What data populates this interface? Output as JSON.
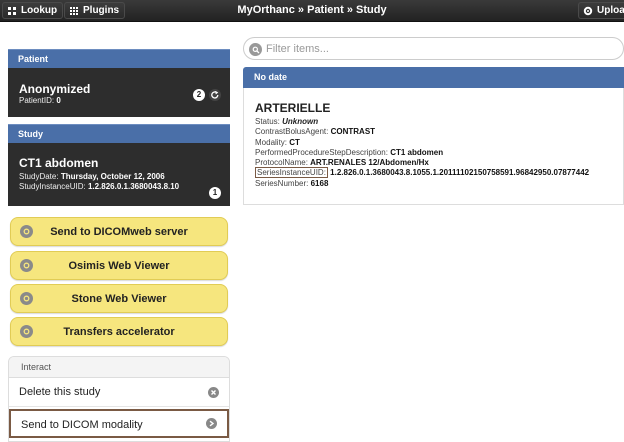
{
  "topbar": {
    "lookup_label": "Lookup",
    "plugins_label": "Plugins",
    "title": "MyOrthanc » Patient » Study",
    "upload_label": "Upload"
  },
  "patient": {
    "header": "Patient",
    "name": "Anonymized",
    "id_label": "PatientID:",
    "id_value": "0",
    "count": "2"
  },
  "study": {
    "header": "Study",
    "name": "CT1 abdomen",
    "date_label": "StudyDate:",
    "date_value": "Thursday, October 12, 2006",
    "uid_label": "StudyInstanceUID:",
    "uid_value": "1.2.826.0.1.3680043.8.10",
    "count": "1"
  },
  "actions": [
    {
      "label": "Send to DICOMweb server"
    },
    {
      "label": "Osimis Web Viewer"
    },
    {
      "label": "Stone Web Viewer"
    },
    {
      "label": "Transfers accelerator"
    }
  ],
  "interact": {
    "header": "Interact",
    "delete_label": "Delete this study",
    "send_modality_label": "Send to DICOM modality"
  },
  "filter": {
    "placeholder": "Filter items..."
  },
  "series_group": {
    "header": "No date"
  },
  "series": {
    "title": "ARTERIELLE",
    "status_label": "Status:",
    "status_value": "Unknown",
    "tags": [
      {
        "key": "ContrastBolusAgent:",
        "value": "CONTRAST"
      },
      {
        "key": "Modality:",
        "value": "CT"
      },
      {
        "key": "PerformedProcedureStepDescription:",
        "value": "CT1 abdomen"
      },
      {
        "key": "ProtocolName:",
        "value": "ART.RENALES 12/Abdomen/Hx"
      },
      {
        "key": "SeriesInstanceUID:",
        "value": "1.2.826.0.1.3680043.8.1055.1.20111102150758591.96842950.07877442"
      },
      {
        "key": "SeriesNumber:",
        "value": "6168"
      }
    ]
  },
  "colors": {
    "section_header": "#4a6fa8",
    "dark_panel": "#2d2d2d",
    "action_button": "#f6e67e",
    "highlight_border": "#7a5a44"
  }
}
